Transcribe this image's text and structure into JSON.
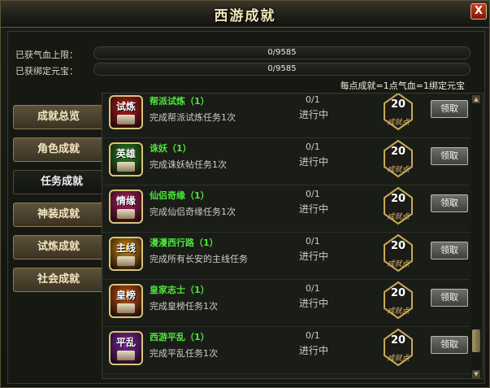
{
  "window": {
    "title": "西游成就",
    "close_label": "X"
  },
  "stats": [
    {
      "label": "已获气血上限：",
      "value_text": "0/9585",
      "fill": 0
    },
    {
      "label": "已获绑定元宝：",
      "value_text": "0/9585",
      "fill": 0
    }
  ],
  "ratio_note": "每点成就=1点气血=1绑定元宝",
  "tabs": [
    {
      "label": "成就总览",
      "active": false
    },
    {
      "label": "角色成就",
      "active": false
    },
    {
      "label": "任务成就",
      "active": true
    },
    {
      "label": "神装成就",
      "active": false
    },
    {
      "label": "试炼成就",
      "active": false
    },
    {
      "label": "社会成就",
      "active": false
    }
  ],
  "achievements": [
    {
      "icon_text": "试炼",
      "icon_color": "#b51a1a",
      "name": "帮派试炼（1）",
      "desc": "完成帮派试炼任务1次",
      "count": "0/1",
      "status": "进行中",
      "points": "20",
      "points_label": "成就点",
      "claim": "领取"
    },
    {
      "icon_text": "英雄",
      "icon_color": "#1f8a22",
      "name": "诛妖（1）",
      "desc": "完成诛妖帖任务1次",
      "count": "0/1",
      "status": "进行中",
      "points": "20",
      "points_label": "成就点",
      "claim": "领取"
    },
    {
      "icon_text": "情缘",
      "icon_color": "#b01c62",
      "name": "仙侣奇缘（1）",
      "desc": "完成仙侣奇缘任务1次",
      "count": "0/1",
      "status": "进行中",
      "points": "20",
      "points_label": "成就点",
      "claim": "领取"
    },
    {
      "icon_text": "主线",
      "icon_color": "#c98a12",
      "name": "漫漫西行路（1）",
      "desc": "完成所有长安的主线任务",
      "count": "0/1",
      "status": "进行中",
      "points": "20",
      "points_label": "成就点",
      "claim": "领取"
    },
    {
      "icon_text": "皇榜",
      "icon_color": "#c9540f",
      "name": "皇家志士（1）",
      "desc": "完成皇榜任务1次",
      "count": "0/1",
      "status": "进行中",
      "points": "20",
      "points_label": "成就点",
      "claim": "领取"
    },
    {
      "icon_text": "平乱",
      "icon_color": "#7a24a8",
      "name": "西游平乱（1）",
      "desc": "完成平乱任务1次",
      "count": "0/1",
      "status": "进行中",
      "points": "20",
      "points_label": "成就点",
      "claim": "领取"
    }
  ]
}
